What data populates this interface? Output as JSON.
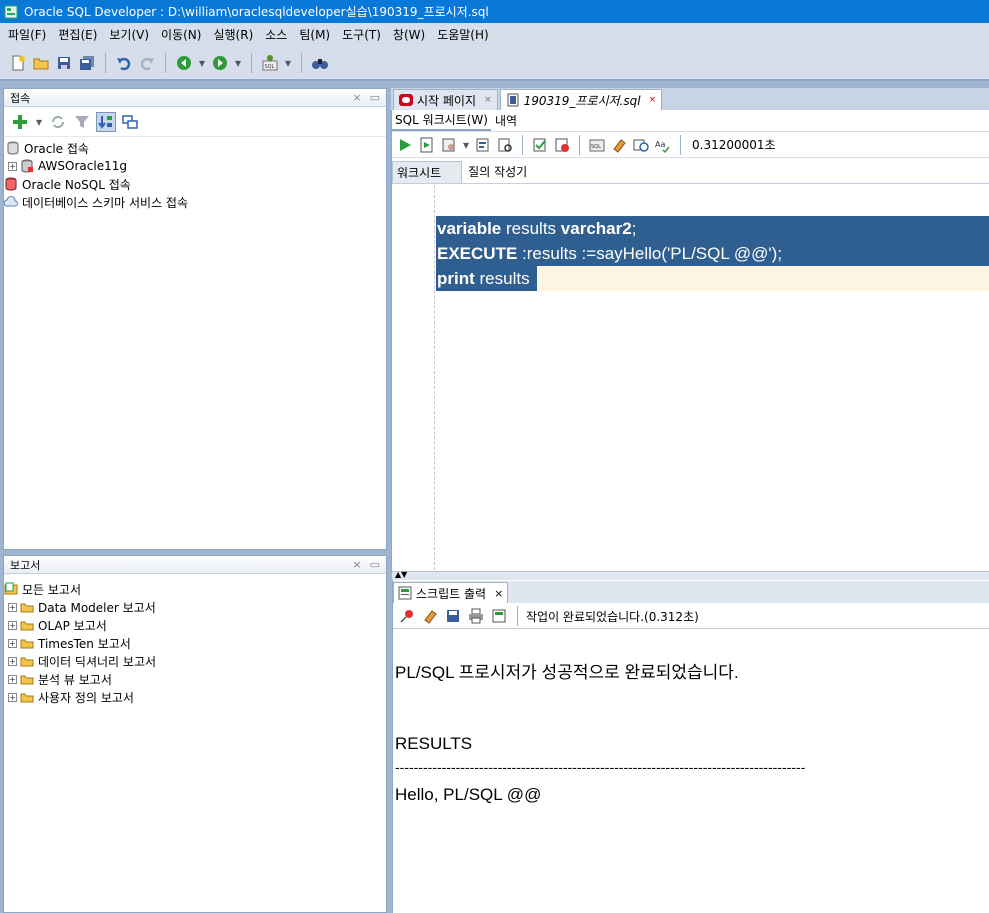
{
  "window": {
    "title": "Oracle SQL Developer : D:\\william\\oraclesqldeveloper실습\\190319_프로시저.sql"
  },
  "menu": [
    "파일(F)",
    "편집(E)",
    "보기(V)",
    "이동(N)",
    "실행(R)",
    "소스",
    "팀(M)",
    "도구(T)",
    "창(W)",
    "도움말(H)"
  ],
  "connections_panel": {
    "title": "접속",
    "items": [
      {
        "label": "Oracle 접속",
        "icon": "database-icon"
      },
      {
        "label": "AWSOracle11g",
        "icon": "connection-icon"
      },
      {
        "label": "Oracle NoSQL 접속",
        "icon": "nosql-icon"
      },
      {
        "label": "데이터베이스 스키마 서비스 접속",
        "icon": "cloud-icon"
      }
    ]
  },
  "reports_panel": {
    "title": "보고서",
    "items": [
      "모든 보고서",
      "Data Modeler 보고서",
      "OLAP 보고서",
      "TimesTen 보고서",
      "데이터 딕셔너리 보고서",
      "분석 뷰 보고서",
      "사용자 정의 보고서"
    ]
  },
  "doc_tabs": [
    {
      "label": "시작 페이지",
      "icon": "oracle-icon"
    },
    {
      "label": "190319_프로시저.sql",
      "icon": "sql-file-icon"
    }
  ],
  "worksheet": {
    "subtabs": [
      "SQL 워크시트(W)",
      "내역"
    ],
    "timing": "0.31200001초",
    "editor_tabs": [
      "워크시트",
      "질의 작성기"
    ],
    "code": {
      "line1_kw1": "variable",
      "line1_t1": " results ",
      "line1_kw2": "varchar2",
      "line1_t2": ";",
      "line2_kw1": "EXECUTE",
      "line2_t1": " :results :=sayHello('PL/SQL @@');",
      "line3_kw1": "print",
      "line3_t1": " results"
    }
  },
  "script_output": {
    "tab_label": "스크립트 출력",
    "status": "작업이 완료되었습니다.(0.312초)",
    "line1": "PL/SQL 프로시저가 성공적으로 완료되었습니다.",
    "line2": "RESULTS",
    "line3": "----------------------------------------------------------------------------------------",
    "line4": "Hello, PL/SQL @@"
  },
  "colors": {
    "titlebar": "#0a78d7",
    "selection": "#2f5f91",
    "current_line": "#fdf6e3"
  }
}
